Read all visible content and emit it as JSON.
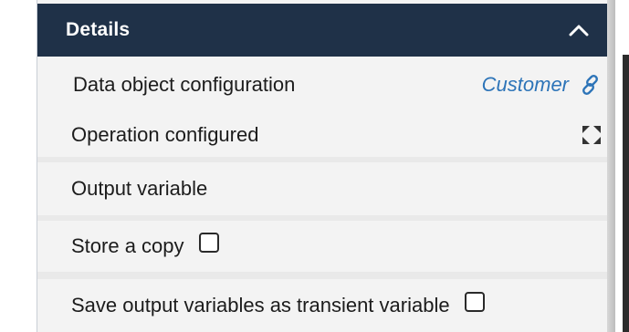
{
  "details_panel": {
    "title": "Details",
    "collapse_icon": "chevron-up-icon",
    "rows": [
      {
        "label": "Data object configuration",
        "link_text": "Customer",
        "link_icon": "link-icon"
      },
      {
        "label": "Operation configured",
        "action_icon": "expand-icon"
      },
      {
        "label": "Output variable"
      },
      {
        "label": "Store a copy",
        "checked": false
      },
      {
        "label": "Save output variables as transient variable",
        "checked": false
      }
    ]
  },
  "colors": {
    "header_bg": "#1f3148",
    "link": "#2d74b8",
    "panel_bg": "#f3f3f3"
  }
}
